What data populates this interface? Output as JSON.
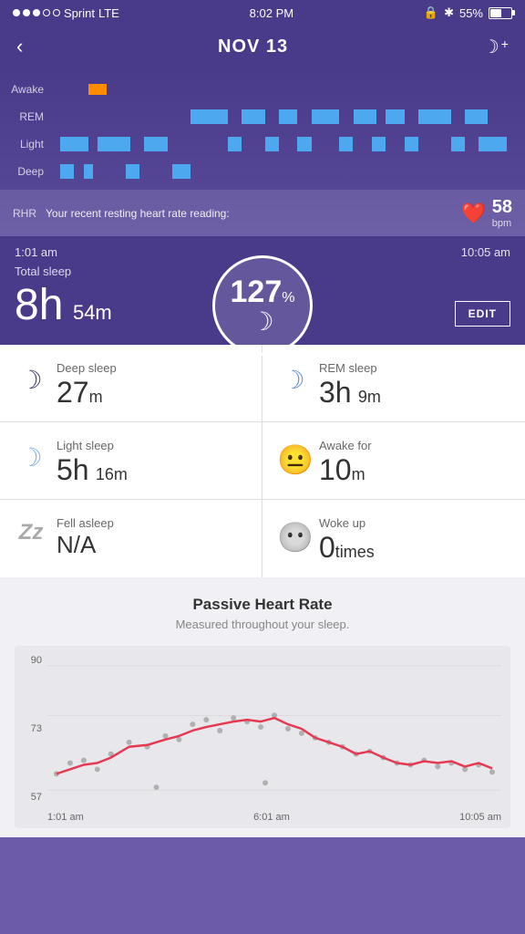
{
  "statusBar": {
    "carrier": "Sprint",
    "network": "LTE",
    "time": "8:02 PM",
    "battery": "55%"
  },
  "nav": {
    "title": "NOV 13",
    "back": "‹",
    "moonPlus": "☾+"
  },
  "sleepStages": {
    "labels": [
      "Awake",
      "REM",
      "Light",
      "Deep"
    ],
    "awake": "Awake",
    "rem": "REM",
    "light": "Light",
    "deep": "Deep"
  },
  "rhr": {
    "label": "RHR",
    "text": "Your recent resting heart rate reading:",
    "value": "58",
    "unit": "bpm"
  },
  "summary": {
    "startTime": "1:01 am",
    "endTime": "10:05 am",
    "totalSleepLabel": "Total sleep",
    "hours": "8h",
    "minutes": "54m",
    "score": "127",
    "scoreSymbol": "%",
    "editLabel": "EDIT"
  },
  "details": [
    {
      "iconType": "moon-dark",
      "icon": "☽",
      "label": "Deep sleep",
      "value": "27m"
    },
    {
      "iconType": "moon-blue",
      "icon": "☽",
      "label": "REM sleep",
      "value": "3h 9m"
    },
    {
      "iconType": "moon-light",
      "icon": "☽",
      "label": "Light sleep",
      "value": "5h 16m"
    },
    {
      "iconType": "emoji",
      "icon": "😐",
      "label": "Awake for",
      "value": "10m"
    },
    {
      "iconType": "zzz",
      "icon": "Zz",
      "label": "Fell asleep",
      "value": "N/A"
    },
    {
      "iconType": "emoji-gray",
      "icon": "😐",
      "label": "Woke up",
      "value": "0 times"
    }
  ],
  "passiveHeartRate": {
    "title": "Passive Heart Rate",
    "subtitle": "Measured throughout your sleep.",
    "yLabels": [
      "90",
      "73",
      "57"
    ],
    "xLabels": [
      "1:01 am",
      "6:01 am",
      "10:05 am"
    ],
    "minVal": 50,
    "maxVal": 95,
    "avgLine": 63
  }
}
